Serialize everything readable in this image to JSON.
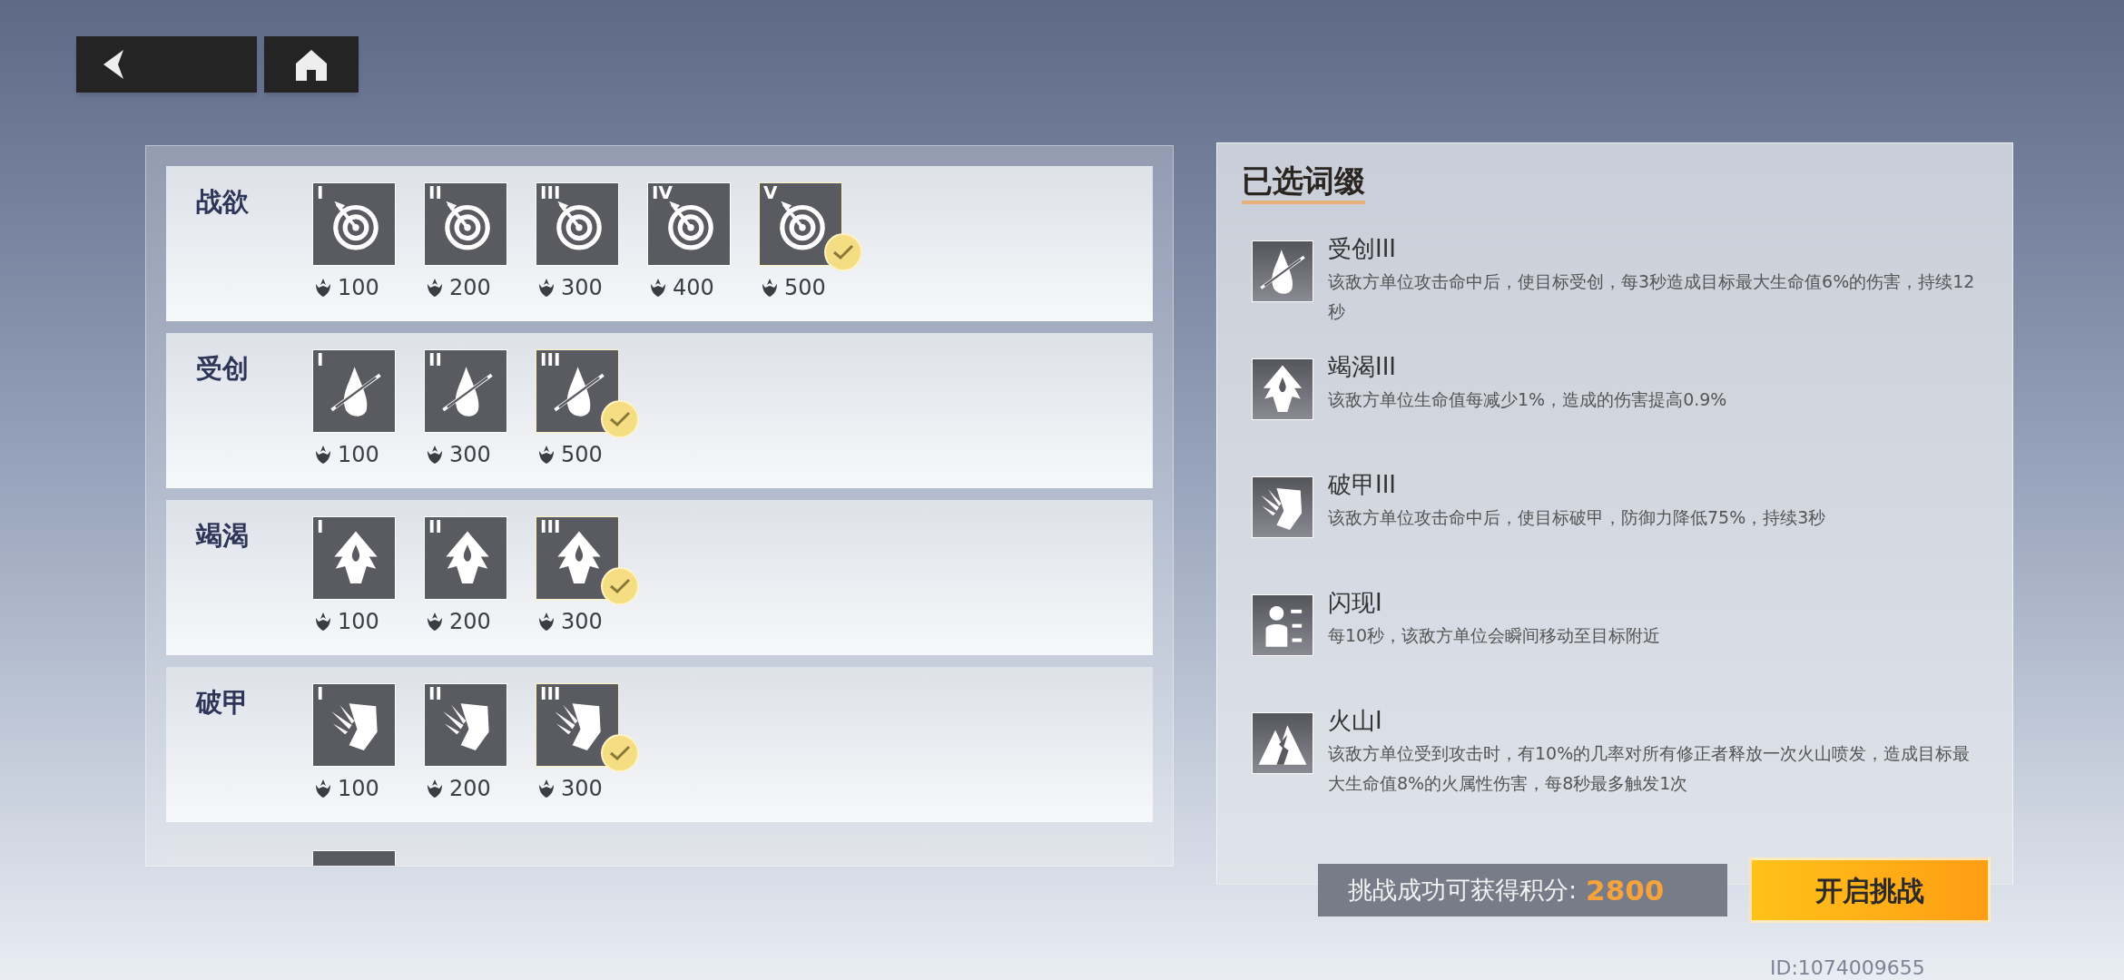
{
  "affix_rows": [
    {
      "label": "战欲",
      "tiers": [
        {
          "numeral": "I",
          "cost": "100",
          "selected": false
        },
        {
          "numeral": "II",
          "cost": "200",
          "selected": false
        },
        {
          "numeral": "III",
          "cost": "300",
          "selected": false
        },
        {
          "numeral": "IV",
          "cost": "400",
          "selected": false
        },
        {
          "numeral": "V",
          "cost": "500",
          "selected": true
        }
      ]
    },
    {
      "label": "受创",
      "tiers": [
        {
          "numeral": "I",
          "cost": "100",
          "selected": false
        },
        {
          "numeral": "II",
          "cost": "300",
          "selected": false
        },
        {
          "numeral": "III",
          "cost": "500",
          "selected": true
        }
      ]
    },
    {
      "label": "竭渴",
      "tiers": [
        {
          "numeral": "I",
          "cost": "100",
          "selected": false
        },
        {
          "numeral": "II",
          "cost": "200",
          "selected": false
        },
        {
          "numeral": "III",
          "cost": "300",
          "selected": true
        }
      ]
    },
    {
      "label": "破甲",
      "tiers": [
        {
          "numeral": "I",
          "cost": "100",
          "selected": false
        },
        {
          "numeral": "II",
          "cost": "200",
          "selected": false
        },
        {
          "numeral": "III",
          "cost": "300",
          "selected": true
        }
      ]
    },
    {
      "partial": true
    }
  ],
  "selected_panel": {
    "title": "已选词缀",
    "items": [
      {
        "name": "受创III",
        "description": "该敌方单位攻击命中后，使目标受创，每3秒造成目标最大生命值6%的伤害，持续12秒"
      },
      {
        "name": "竭渴III",
        "description": "该敌方单位生命值每减少1%，造成的伤害提高0.9%"
      },
      {
        "name": "破甲III",
        "description": "该敌方单位攻击命中后，使目标破甲，防御力降低75%，持续3秒"
      },
      {
        "name": "闪现I",
        "description": "每10秒，该敌方单位会瞬间移动至目标附近"
      },
      {
        "name": "火山I",
        "description": "该敌方单位受到攻击时，有10%的几率对所有修正者释放一次火山喷发，造成目标最大生命值8%的火属性伤害，每8秒最多触发1次"
      }
    ]
  },
  "reward": {
    "label": "挑战成功可获得积分:",
    "points": "2800"
  },
  "start_button": "开启挑战",
  "player_id": "ID:1074009655"
}
